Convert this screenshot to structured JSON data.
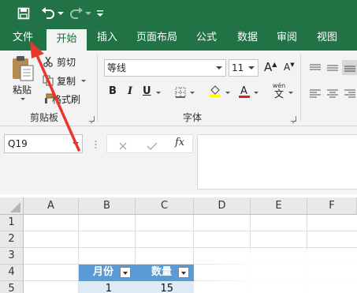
{
  "quick_access": {
    "icons": [
      "save-icon",
      "undo-icon",
      "redo-icon",
      "customize-icon"
    ]
  },
  "tabs": [
    {
      "label": "文件",
      "active": false
    },
    {
      "label": "开始",
      "active": true
    },
    {
      "label": "插入",
      "active": false
    },
    {
      "label": "页面布局",
      "active": false
    },
    {
      "label": "公式",
      "active": false
    },
    {
      "label": "数据",
      "active": false
    },
    {
      "label": "审阅",
      "active": false
    },
    {
      "label": "视图",
      "active": false
    }
  ],
  "ribbon": {
    "clipboard": {
      "paste": "粘贴",
      "cut": "剪切",
      "copy": "复制",
      "format_painter": "格式刷",
      "group_label": "剪贴板"
    },
    "font": {
      "font_name": "等线",
      "font_size": "11",
      "bold": "B",
      "italic": "I",
      "underline": "U",
      "phonetic": "wén",
      "phonetic_sub": "文",
      "grow": "A",
      "shrink": "A",
      "group_label": "字体"
    }
  },
  "formula_bar": {
    "name_box": "Q19",
    "fx": "fx",
    "value": ""
  },
  "grid": {
    "columns": [
      "A",
      "B",
      "C",
      "D",
      "E",
      "F"
    ],
    "rows": [
      "1",
      "2",
      "3",
      "4",
      "5"
    ],
    "table": {
      "headers": [
        "月份",
        "数量"
      ],
      "rows": [
        [
          "1",
          "15"
        ]
      ]
    }
  },
  "colors": {
    "brand": "#217346",
    "table_header": "#5b9bd5",
    "table_band": "#ddebf7",
    "annotation_arrow": "#e8372c"
  }
}
